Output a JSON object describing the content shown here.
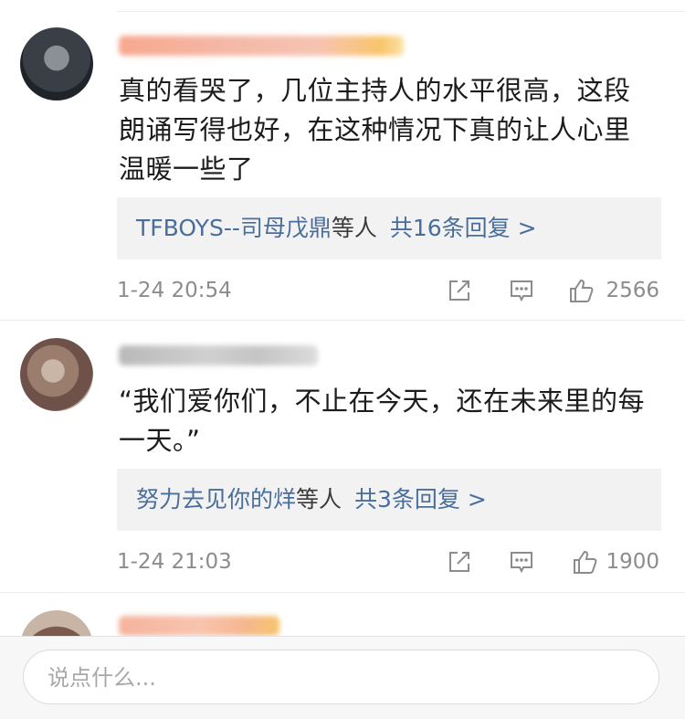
{
  "comments": [
    {
      "text": "真的看哭了，几位主持人的水平很高，这段\n朗诵写得也好，在这种情况下真的让人心里\n温暖一些了",
      "replies": {
        "names": "TFBOYS--司母戊鼎",
        "mid": "等人",
        "count": "共16条回复 >"
      },
      "time": "1-24 20:54",
      "likes": "2566"
    },
    {
      "text": "“我们爱你们，不止在今天，还在未来里的每\n一天。”",
      "replies": {
        "names": "努力去见你的烊",
        "mid": "等人",
        "count": "共3条回复 >"
      },
      "time": "1-24 21:03",
      "likes": "1900"
    }
  ],
  "icons": [
    "share-icon",
    "comment-icon",
    "like-icon"
  ],
  "colors": {
    "link": "#4a6e9c",
    "reply_bg": "#f2f2f2",
    "meta": "#8c8c8c"
  },
  "input": {
    "placeholder": "说点什么..."
  }
}
